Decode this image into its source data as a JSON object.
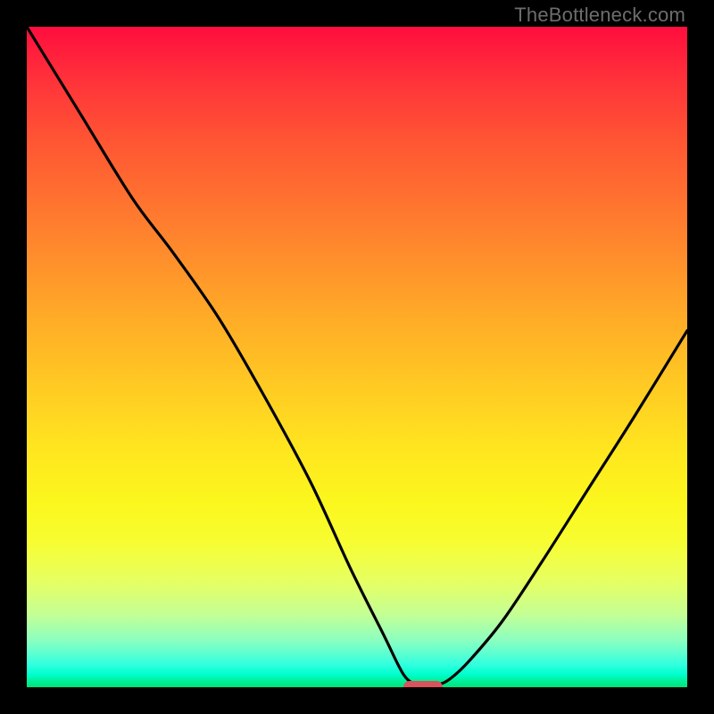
{
  "watermark": "TheBottleneck.com",
  "accent_marker_color": "#d9535b",
  "chart_data": {
    "type": "line",
    "xlabel": "",
    "ylabel": "",
    "xlim": [
      0,
      100
    ],
    "ylim": [
      0,
      100
    ],
    "grid": false,
    "legend": false,
    "title": "",
    "series": [
      {
        "name": "bottleneck-curve",
        "x": [
          0,
          8,
          16,
          22,
          29,
          36,
          43,
          49,
          54,
          57,
          59,
          60,
          62,
          64,
          67,
          72,
          78,
          85,
          92,
          100
        ],
        "y": [
          100,
          87,
          74,
          66,
          56,
          44,
          31,
          18,
          8,
          2,
          0.3,
          0,
          0.3,
          1.2,
          4,
          10,
          19,
          30,
          41,
          54
        ]
      }
    ],
    "marker": {
      "x": 60,
      "y": 0,
      "width_pct": 6,
      "height_pct": 2
    },
    "background_gradient": [
      "#ff0d3e",
      "#ff323a",
      "#ff5833",
      "#ff7e2e",
      "#ffa528",
      "#ffc923",
      "#ffe81f",
      "#fbf71d",
      "#f7fd31",
      "#e6ff62",
      "#c4ff95",
      "#8affc1",
      "#34ffde",
      "#00ffd0",
      "#00f19a",
      "#00e27a"
    ]
  }
}
